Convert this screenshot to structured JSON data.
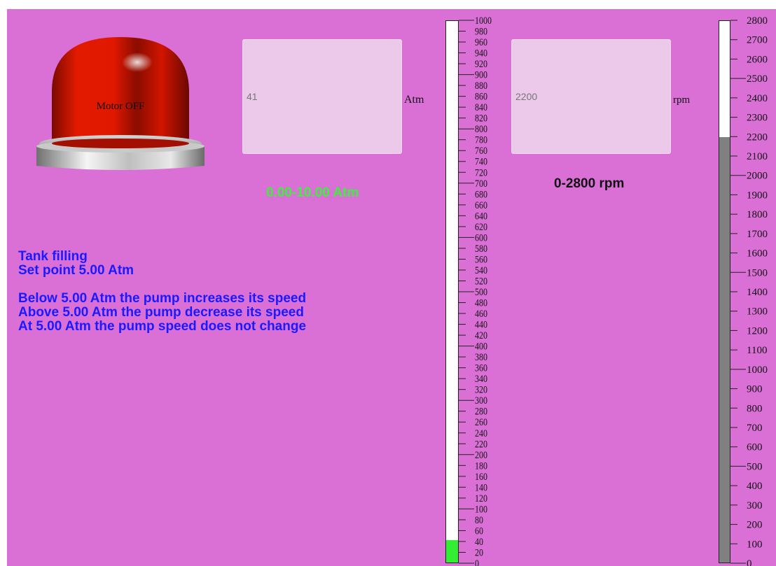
{
  "motor": {
    "label": "Motor OFF"
  },
  "pressure": {
    "value": "41",
    "unit": "Atm",
    "range_label": "0.00-10.00 Atm",
    "level": 41,
    "scale_min": 0,
    "scale_max": 1000,
    "scale_step": 20,
    "fill_color": "#33ee33"
  },
  "speed": {
    "value": "2200",
    "unit": "rpm",
    "range_label": "0-2800 rpm",
    "level": 2200,
    "scale_min": 0,
    "scale_max": 2800,
    "scale_step": 100,
    "fill_color": "#808080"
  },
  "info": {
    "line1": "Tank filling",
    "line2": "Set point 5.00 Atm",
    "line3": "Below 5.00 Atm the pump increases its speed",
    "line4": "Above 5.00 Atm the pump decrease its speed",
    "line5": "At 5.00 Atm the pump speed does not change"
  },
  "colors": {
    "panel": "#da70d6",
    "info_text": "#1a1aff",
    "pressure_range_text": "#3cf03c"
  }
}
